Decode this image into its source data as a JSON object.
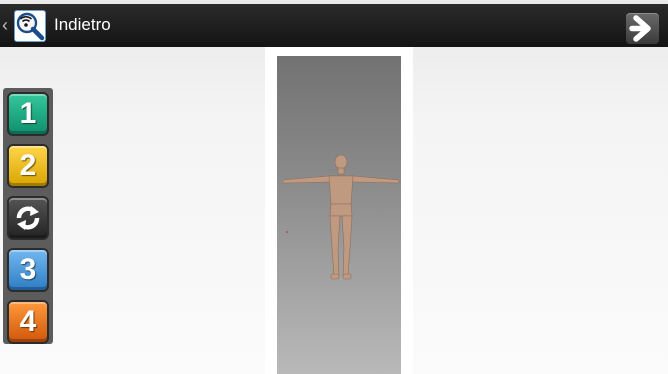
{
  "header": {
    "back_glyph": "‹",
    "title": "Indietro",
    "app_icon": "magnifier-wifi-icon",
    "next_icon": "arrow-right-icon"
  },
  "sidebar": {
    "buttons": [
      {
        "label": "1",
        "color": "#1faa82"
      },
      {
        "label": "2",
        "color": "#f2bf12"
      },
      {
        "label": "",
        "icon": "refresh-icon",
        "color": "#333333"
      },
      {
        "label": "3",
        "color": "#4a9ee0"
      },
      {
        "label": "4",
        "color": "#ec7420"
      }
    ]
  },
  "viewer": {
    "content": "human-figure-3d-model",
    "skin_color": "#c09a80"
  }
}
